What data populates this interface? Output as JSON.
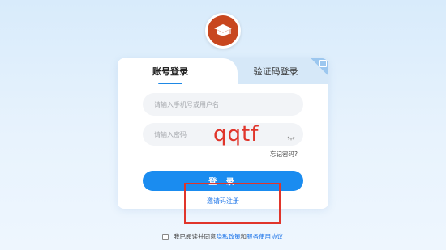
{
  "tabs": {
    "account_login": "账号登录",
    "code_login": "验证码登录"
  },
  "form": {
    "username_placeholder": "请输入手机号或用户名",
    "password_placeholder": "请输入密码",
    "forgot_password": "忘记密码?",
    "login_button": "登 录",
    "invite_register": "邀请码注册"
  },
  "overlay": {
    "text": "qqtf"
  },
  "agreement": {
    "prefix": "我已阅读并同意",
    "privacy_policy": "隐私政策",
    "and": "和",
    "service_agreement": "服务使用协议"
  },
  "colors": {
    "accent": "#1a8cf0",
    "logo": "#c8471f",
    "annotation": "#e0352b"
  },
  "icons": {
    "logo": "graduation-cap-logo",
    "qr_corner": "qr-code-icon",
    "password_toggle": "eye-closed-icon"
  }
}
